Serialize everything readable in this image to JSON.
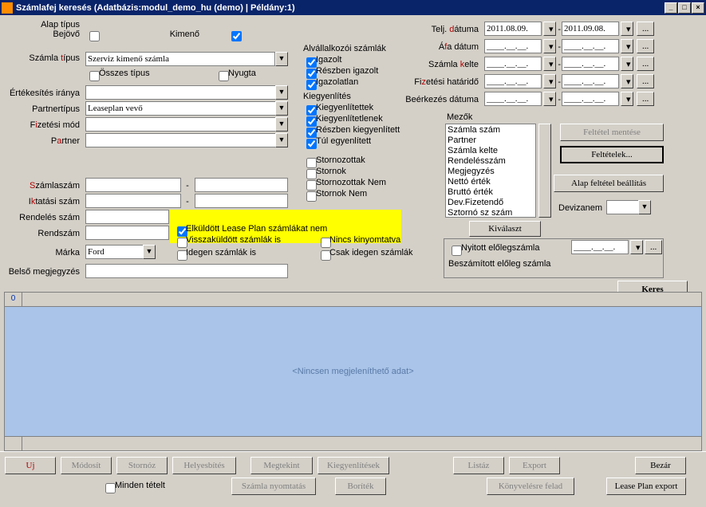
{
  "window": {
    "title": "Számlafej keresés   (Adatbázis:modul_demo_hu (demo) | Példány:1)"
  },
  "labels": {
    "alap_tipus": "Alap típus",
    "bejovo": "Bejövő",
    "kimeno": "Kimenő",
    "szamla_tipus_pre": "Számla ",
    "szamla_tipus_key": "t",
    "szamla_tipus_post": "ípus",
    "osszes_tipus": "Összes típus",
    "nyugta": "Nyugta",
    "ertek_iranya": "Értékesítés iránya",
    "partnertipus": "Partnertípus",
    "fizmod_pre": "F",
    "fizmod_key": "i",
    "fizmod_post": "zetési mód",
    "partner_pre": "P",
    "partner_key": "a",
    "partner_post": "rtner",
    "szlaszam_pre": "S",
    "szlaszam_key": "z",
    "szlaszam_post": "ámlaszám",
    "iktszam_pre": "I",
    "iktszam_key": "k",
    "iktszam_post": "tatási szám",
    "rendszam": "Rendelés szám",
    "rendszam2": "Rendszám",
    "marka": "Márka",
    "belso_mj": "Belső megjegyzés",
    "elkuldott": "Elküldött Lease Plan számlákat nem",
    "visszakuldott": "Visszaküldött számlák is",
    "idegen": "Idegen számlák is",
    "nincs_kinyom": "Nincs kinyomtatva",
    "csak_idegen": "Csak idegen számlák"
  },
  "groups": {
    "alvallalkozoi": "Alvállalkozói számlák",
    "igazolt": "Igazolt",
    "reszben_igazolt": "Részben igazolt",
    "igazolatlan": "Igazolatlan",
    "kiegyenlites": "Kiegyenlítés",
    "kiegyenlitettek": "Kiegyenlítettek",
    "kiegyenlitetlenek": "Kiegyenlítetlenek",
    "reszben_kiegy": "Részben kiegyenlített",
    "tul_egy": "Túl egyenlített",
    "stornozottak": "Stornozottak",
    "stornok": "Stornok",
    "storn_nem": "Stornozottak Nem",
    "stornok_nem": "Stornok Nem"
  },
  "dates": {
    "telj_pre": "Telj. ",
    "telj_key": "d",
    "telj_post": "átuma",
    "afa_pre": "Á",
    "afa_key": "f",
    "afa_post": "a dátum",
    "kelte_pre": "Számla ",
    "kelte_key": "k",
    "kelte_post": "elte",
    "fizhat_pre": "Fi",
    "fizhat_key": "z",
    "fizhat_post": "etési határidő",
    "beerkezes": "Beérkezés dátuma",
    "from": "2011.08.09.",
    "to": "2011.09.08.",
    "empty": "____.__.__."
  },
  "mezok": {
    "title": "Mezők",
    "items": [
      "Számla szám",
      "Partner",
      "Számla kelte",
      "Rendelésszám",
      "Megjegyzés",
      "Nettó érték",
      "Bruttó érték",
      "Dev.Fizetendő",
      "Sztornó sz szám"
    ],
    "kivalaszt": "Kiválaszt",
    "feltetel_mentese": "Feltétel mentése",
    "feltetelek": "Feltételek...",
    "alap_felt": "Alap feltétel beállítás",
    "devizanem": "Devizanem"
  },
  "extra": {
    "nyitott_eloleg": "Nyitott előlegszámla",
    "beszamitott": "Beszámított előleg számla",
    "keres": "Keres"
  },
  "grid": {
    "headerCount": "0",
    "empty": "<Nincsen megjeleníthető adat>"
  },
  "buttons": {
    "uj": "Uj",
    "modosit": "Módosít",
    "stornoz": "Stornóz",
    "helyesbites": "Helyesbítés",
    "megtekint": "Megtekint",
    "kiegyenlitesek": "Kiegyenlítések",
    "listaz": "Listáz",
    "export": "Export",
    "bezar": "Bezár",
    "minden_tetelt": "Minden tételt",
    "szla_nyomtatas": "Számla nyomtatás",
    "boritek": "Boríték",
    "konyv_felad": "Könyvelésre felad",
    "lp_export": "Lease Plan export"
  },
  "values": {
    "szamla_tipus": "Szerviz kimenő számla",
    "partnertipus": "Leaseplan vevő",
    "marka": "Ford"
  }
}
